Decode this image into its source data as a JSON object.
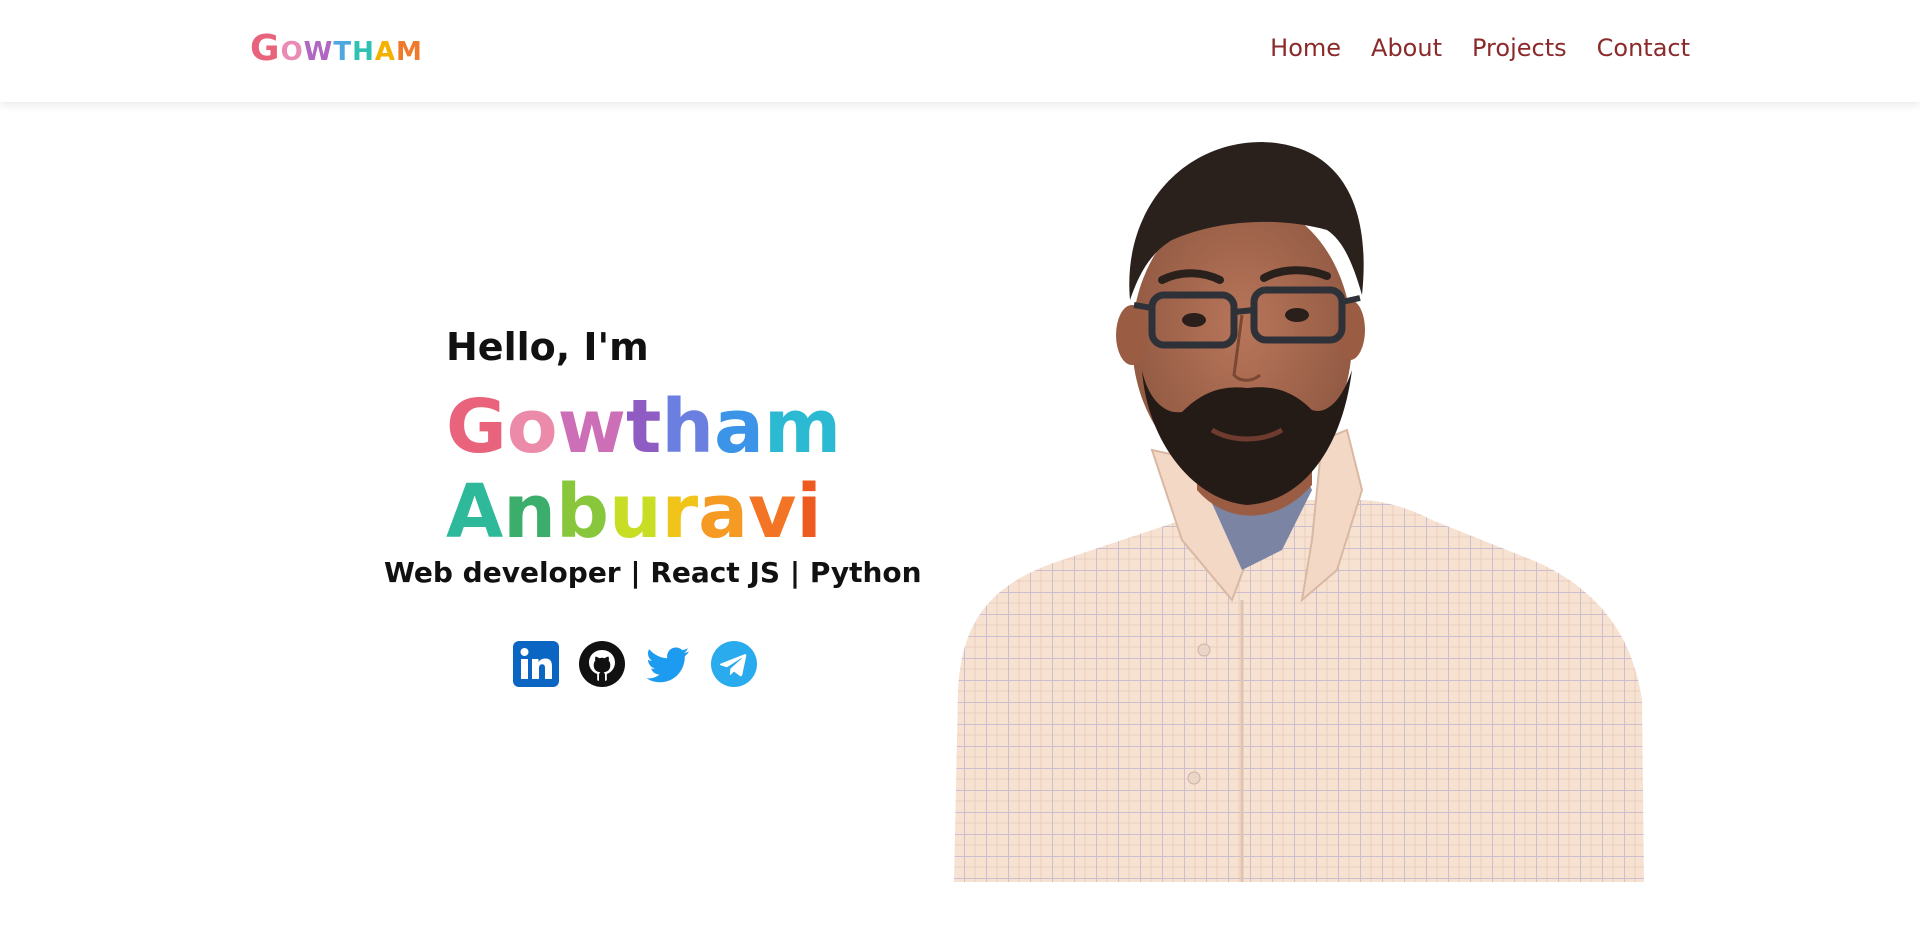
{
  "logo": {
    "letters": [
      {
        "char": "G",
        "color": "#e8637b",
        "size": "big"
      },
      {
        "char": "O",
        "color": "#e98bb4",
        "size": "small"
      },
      {
        "char": "W",
        "color": "#b067c2",
        "size": "small"
      },
      {
        "char": "T",
        "color": "#4ea8e0",
        "size": "small"
      },
      {
        "char": "H",
        "color": "#2fc2b3",
        "size": "small"
      },
      {
        "char": "A",
        "color": "#f5b100",
        "size": "small"
      },
      {
        "char": "M",
        "color": "#f07a2c",
        "size": "small"
      }
    ]
  },
  "nav": {
    "home": "Home",
    "about": "About",
    "projects": "Projects",
    "contact": "Contact"
  },
  "hero": {
    "greeting": "Hello, I'm",
    "first_name": [
      {
        "char": "G",
        "color": "#e8637b"
      },
      {
        "char": "o",
        "color": "#ec8aa9"
      },
      {
        "char": "w",
        "color": "#cc6fb6"
      },
      {
        "char": "t",
        "color": "#8e5cc2"
      },
      {
        "char": "h",
        "color": "#6a7fe0"
      },
      {
        "char": "a",
        "color": "#3b94e8"
      },
      {
        "char": "m",
        "color": "#2cbad2"
      }
    ],
    "last_name": [
      {
        "char": "A",
        "color": "#2fb99b"
      },
      {
        "char": "n",
        "color": "#3aae6a"
      },
      {
        "char": "b",
        "color": "#88c63c"
      },
      {
        "char": "u",
        "color": "#c8de24"
      },
      {
        "char": "r",
        "color": "#f0c418"
      },
      {
        "char": "a",
        "color": "#f59a22"
      },
      {
        "char": "v",
        "color": "#f27424"
      },
      {
        "char": "i",
        "color": "#ee5b20"
      }
    ],
    "tagline": "Web developer | React JS | Python"
  },
  "social_icons": [
    {
      "name": "linkedin-icon",
      "color": "#0a66c2"
    },
    {
      "name": "github-icon",
      "color": "#111111"
    },
    {
      "name": "twitter-icon",
      "color": "#1d9bf0"
    },
    {
      "name": "telegram-icon",
      "color": "#2aabee"
    }
  ],
  "colors": {
    "nav_link": "#8b2a2a",
    "text": "#111111",
    "shirt": "#f7e2d2",
    "skin": "#a8674a",
    "hair": "#2a211d"
  }
}
